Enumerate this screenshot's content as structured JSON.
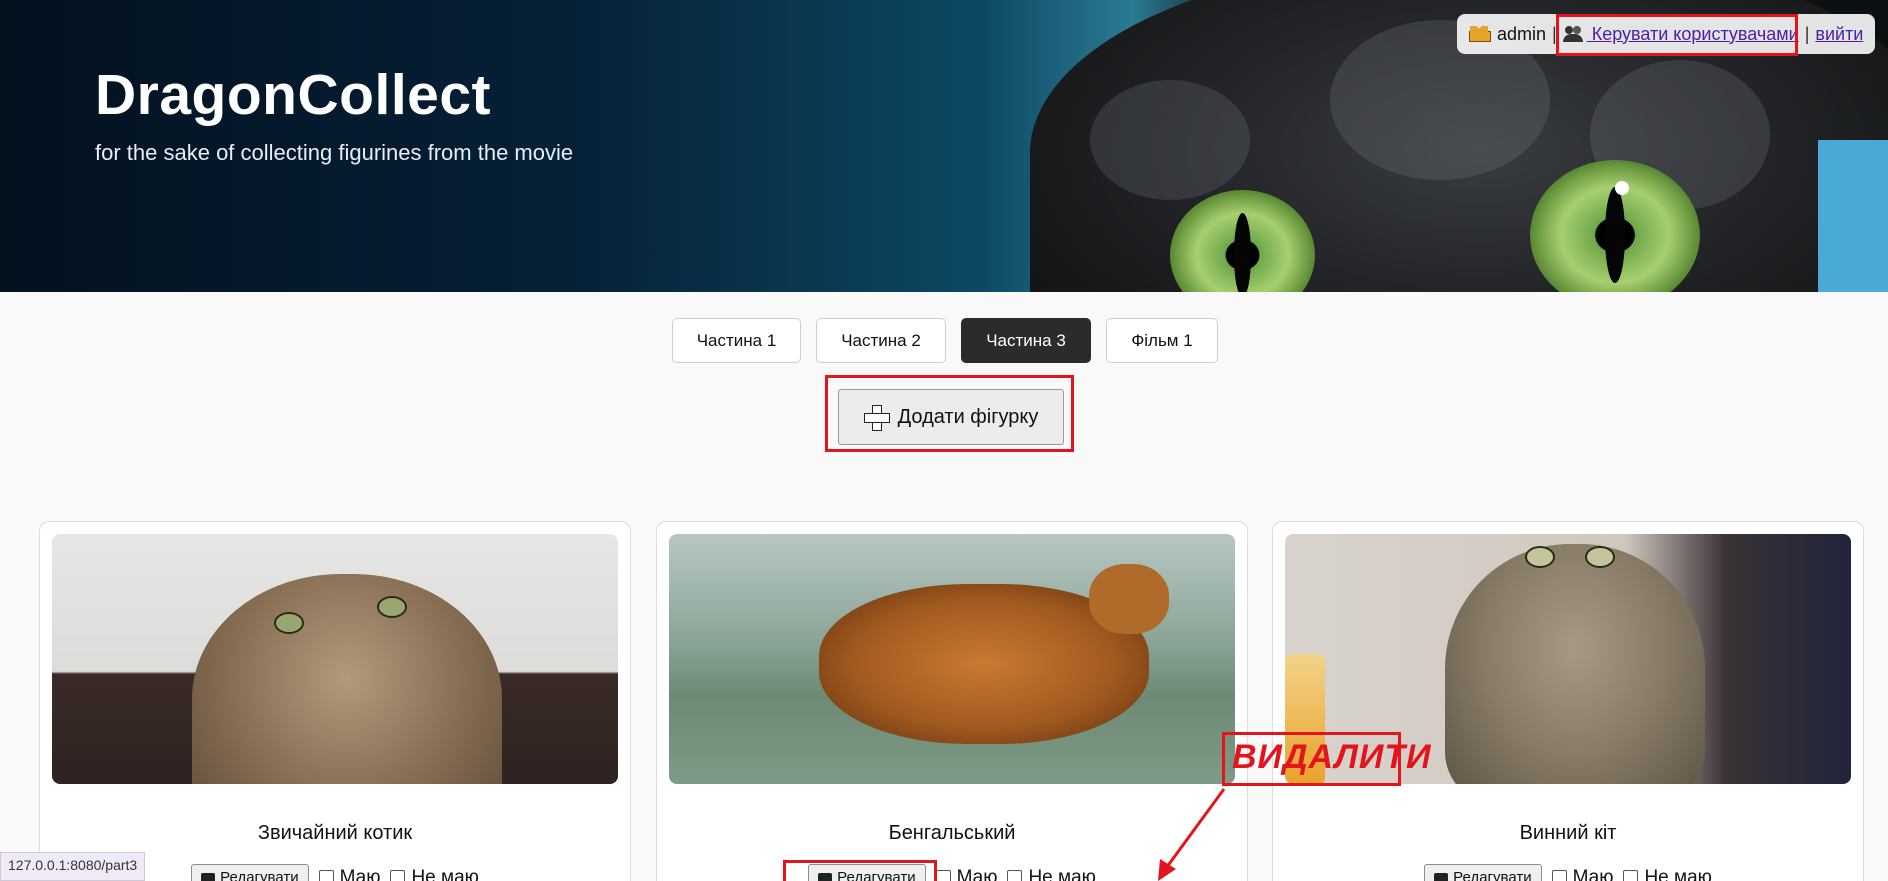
{
  "header": {
    "brand": "DragonCollect",
    "tagline": "for the sake of collecting figurines from the movie",
    "user": {
      "name": "admin",
      "manage_users_link": " Керувати користувачами",
      "separator": "|",
      "logout_link": "вийти"
    }
  },
  "tabs": [
    {
      "label": "Частина 1",
      "active": false
    },
    {
      "label": "Частина 2",
      "active": false
    },
    {
      "label": "Частина 3",
      "active": true
    },
    {
      "label": "Фільм 1",
      "active": false
    }
  ],
  "add_button": {
    "label": "Додати фігурку"
  },
  "cards": [
    {
      "name": "Звичайний котик",
      "edit_label": "Редагувати",
      "have_label": "Маю",
      "not_have_label": "Не маю"
    },
    {
      "name": "Бенгальський",
      "edit_label": "Редагувати",
      "have_label": "Маю",
      "not_have_label": "Не маю"
    },
    {
      "name": "Винний кіт",
      "edit_label": "Редагувати",
      "have_label": "Маю",
      "not_have_label": "Не маю"
    }
  ],
  "annotation": {
    "text": "ВИДАЛИТИ",
    "color": "#e3141b"
  },
  "status_bar": {
    "url": "127.0.0.1:8080/part3"
  },
  "colors": {
    "active_tab": "#2b2b2b",
    "link": "#4b1fa8",
    "highlight": "#e3141b"
  }
}
